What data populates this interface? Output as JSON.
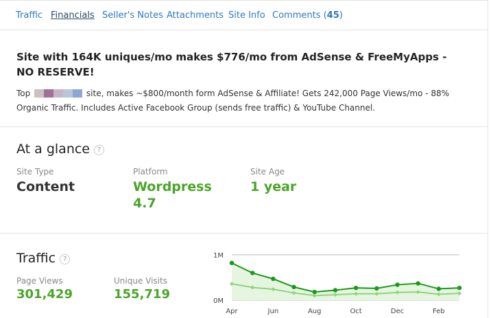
{
  "tabs": [
    {
      "label": "Traffic",
      "active": false
    },
    {
      "label": "Financials",
      "active": true
    },
    {
      "label": "Seller's Notes",
      "active": false
    },
    {
      "label": "Attachments",
      "active": false
    },
    {
      "label": "Site Info",
      "active": false
    },
    {
      "label": "Comments (",
      "count": "45",
      "suffix": ")",
      "active": false
    }
  ],
  "listing": {
    "title": "Site with 164K uniques/mo makes $776/mo from AdSense & FreeMyApps - NO RESERVE!",
    "desc_prefix": "Top",
    "desc_rest": "site, makes ~$800/month form AdSense & Affiliate! Gets 242,000 Page Views/mo - 88% Organic Traffic. Includes Active Facebook Group (sends free traffic) & YouTube Channel.",
    "redacted_colors": [
      "#c8c1bf",
      "#a0709a",
      "#c8b4c8",
      "#b9c6da",
      "#8fa6d4"
    ]
  },
  "glance": {
    "title": "At a glance",
    "help_icon": "?",
    "site_type_label": "Site Type",
    "site_type_value": "Content",
    "platform_label": "Platform",
    "platform_value_line1": "Wordpress",
    "platform_value_line2": "4.7",
    "site_age_label": "Site Age",
    "site_age_value": "1 year"
  },
  "traffic": {
    "title": "Traffic",
    "help_icon": "?",
    "page_views_label": "Page Views",
    "page_views_value": "301,429",
    "unique_visits_label": "Unique Visits",
    "unique_visits_value": "155,719"
  },
  "colors": {
    "accent_green": "#4aa528",
    "link_blue": "#2a79c2",
    "series_page_views": "#1a9a1a",
    "series_unique_visits": "#8fd47a",
    "area_fill": "#e6f5e0"
  },
  "chart_data": {
    "type": "line",
    "x": [
      "Apr",
      "May",
      "Jun",
      "Jul",
      "Aug",
      "Sep",
      "Oct",
      "Nov",
      "Dec",
      "Jan",
      "Feb",
      "Mar"
    ],
    "x_tick_labels": [
      "Apr",
      "Jun",
      "Aug",
      "Oct",
      "Dec",
      "Feb"
    ],
    "y_tick_labels": [
      "1M",
      "0M"
    ],
    "ylim": [
      0,
      1000000
    ],
    "series": [
      {
        "values": [
          820000,
          600000,
          470000,
          290000,
          180000,
          220000,
          270000,
          260000,
          340000,
          370000,
          250000,
          270000
        ]
      },
      {
        "values": [
          360000,
          280000,
          240000,
          160000,
          100000,
          120000,
          140000,
          140000,
          170000,
          180000,
          130000,
          150000
        ]
      }
    ],
    "grid": true,
    "legend": "none"
  }
}
